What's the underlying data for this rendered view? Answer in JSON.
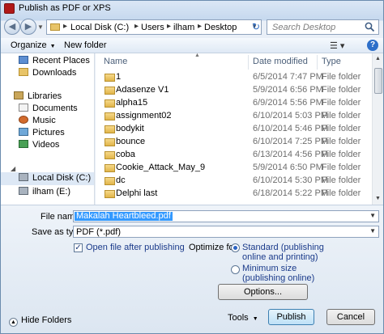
{
  "window": {
    "title": "Publish as PDF or XPS"
  },
  "address": {
    "crumbs": [
      "Local Disk (C:)",
      "Users",
      "ilham",
      "Desktop"
    ]
  },
  "search": {
    "placeholder": "Search Desktop"
  },
  "toolbar": {
    "organize": "Organize",
    "new_folder": "New folder"
  },
  "sidebar": {
    "items": [
      {
        "label": "Recent Places",
        "icon": "recent-places-icon"
      },
      {
        "label": "Downloads",
        "icon": "downloads-icon"
      },
      {
        "label": "Libraries",
        "icon": "libraries-icon"
      },
      {
        "label": "Documents",
        "icon": "documents-icon"
      },
      {
        "label": "Music",
        "icon": "music-icon"
      },
      {
        "label": "Pictures",
        "icon": "pictures-icon"
      },
      {
        "label": "Videos",
        "icon": "videos-icon"
      },
      {
        "label": "Local Disk (C:)",
        "icon": "local-disk-icon"
      },
      {
        "label": "ilham (E:)",
        "icon": "drive-icon"
      }
    ]
  },
  "filelist": {
    "columns": {
      "name": "Name",
      "date": "Date modified",
      "type": "Type"
    },
    "rows": [
      {
        "name": "1",
        "date": "6/5/2014 7:47 PM",
        "type": "File folder"
      },
      {
        "name": "Adasenze V1",
        "date": "5/9/2014 6:56 PM",
        "type": "File folder"
      },
      {
        "name": "alpha15",
        "date": "6/9/2014 5:56 PM",
        "type": "File folder"
      },
      {
        "name": "assignment02",
        "date": "6/10/2014 5:03 PM",
        "type": "File folder"
      },
      {
        "name": "bodykit",
        "date": "6/10/2014 5:46 PM",
        "type": "File folder"
      },
      {
        "name": "bounce",
        "date": "6/10/2014 7:25 PM",
        "type": "File folder"
      },
      {
        "name": "coba",
        "date": "6/13/2014 4:56 PM",
        "type": "File folder"
      },
      {
        "name": "Cookie_Attack_May_9",
        "date": "5/9/2014 6:50 PM",
        "type": "File folder"
      },
      {
        "name": "dc",
        "date": "6/10/2014 5:30 PM",
        "type": "File folder"
      },
      {
        "name": "Delphi last",
        "date": "6/18/2014 5:22 PM",
        "type": "File folder"
      }
    ]
  },
  "form": {
    "file_name_label": "File name:",
    "file_name_value": "Makalah Heartbleed.pdf",
    "save_type_label": "Save as type:",
    "save_type_value": "PDF (*.pdf)",
    "open_after_label": "Open file after publishing",
    "open_after_checked": true,
    "optimize_label": "Optimize for:",
    "standard_line1": "Standard (publishing",
    "standard_line2": "online and printing)",
    "minimum_line1": "Minimum size",
    "minimum_line2": "(publishing online)",
    "selected_optimize": "standard",
    "options_button": "Options..."
  },
  "footer": {
    "hide_folders": "Hide Folders",
    "tools": "Tools",
    "publish": "Publish",
    "cancel": "Cancel"
  },
  "colors": {
    "selection": "#3399ff",
    "accent": "#2a63c4"
  }
}
